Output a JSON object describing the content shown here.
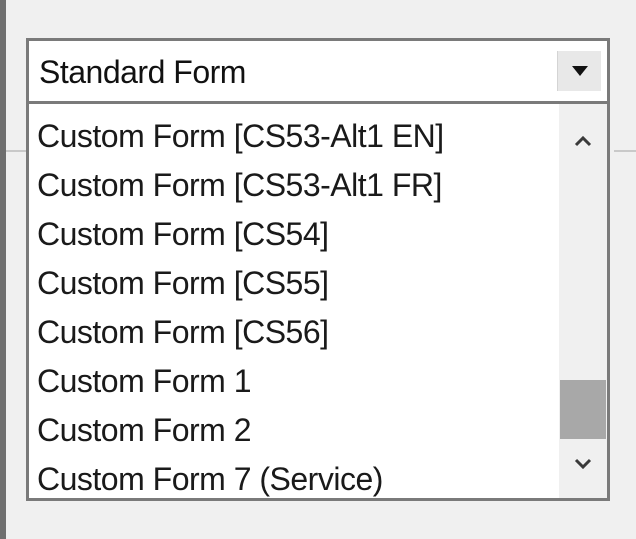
{
  "combo": {
    "selected_value": "Standard Form",
    "dropdown_icon": "triangle-down-icon"
  },
  "list": {
    "items": [
      "Custom Form [CS53-Alt1 EN]",
      "Custom Form [CS53-Alt1 FR]",
      "Custom Form [CS54]",
      "Custom Form [CS55]",
      "Custom Form [CS56]",
      "Custom Form 1",
      "Custom Form 2",
      "Custom Form 7 (Service)"
    ]
  },
  "scrollbar": {
    "up_icon": "chevron-up-icon",
    "down_icon": "chevron-down-icon",
    "thumb_start_fraction": 0.78,
    "thumb_end_fraction": 0.99,
    "thumb_color": "#a8a8a8"
  }
}
